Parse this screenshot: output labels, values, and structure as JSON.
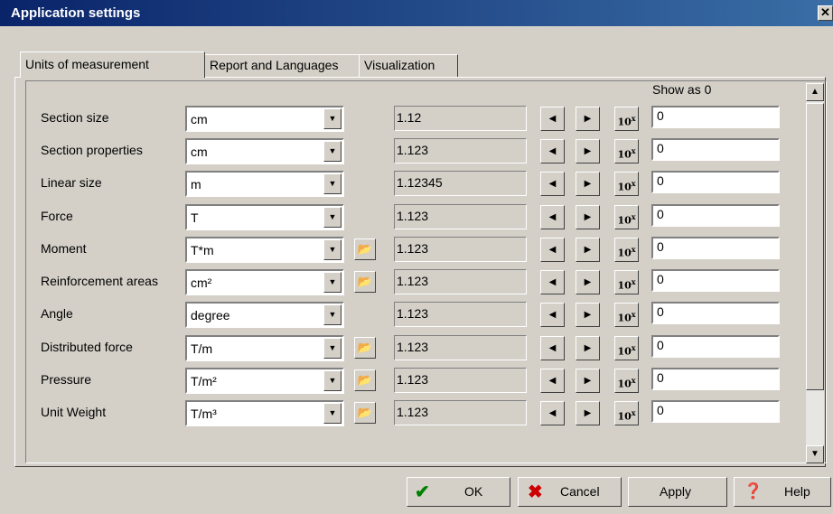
{
  "window": {
    "title": "Application settings",
    "close_glyph": "✕"
  },
  "tabs": [
    {
      "label": "Units of measurement",
      "active": true
    },
    {
      "label": "Report and Languages",
      "active": false
    },
    {
      "label": "Visualization",
      "active": false
    }
  ],
  "header": {
    "show_as_zero": "Show as 0"
  },
  "icons": {
    "left_arrow": "◀",
    "right_arrow": "▶",
    "dropdown": "▼",
    "folder": "📂",
    "power_base": "10",
    "power_exp": "x",
    "scroll_up": "▲",
    "scroll_down": "▼"
  },
  "rows": [
    {
      "label": "Section size",
      "unit": "cm",
      "has_folder": false,
      "format": "1.12",
      "zero": "0"
    },
    {
      "label": "Section properties",
      "unit": "cm",
      "has_folder": false,
      "format": "1.123",
      "zero": "0"
    },
    {
      "label": "Linear size",
      "unit": "m",
      "has_folder": false,
      "format": "1.12345",
      "zero": "0"
    },
    {
      "label": "Force",
      "unit": "T",
      "has_folder": false,
      "format": "1.123",
      "zero": "0"
    },
    {
      "label": "Moment",
      "unit": "T*m",
      "has_folder": true,
      "format": "1.123",
      "zero": "0"
    },
    {
      "label": "Reinforcement areas",
      "unit": "cm²",
      "has_folder": true,
      "format": "1.123",
      "zero": "0"
    },
    {
      "label": "Angle",
      "unit": "degree",
      "has_folder": false,
      "format": "1.123",
      "zero": "0"
    },
    {
      "label": "Distributed force",
      "unit": "T/m",
      "has_folder": true,
      "format": "1.123",
      "zero": "0"
    },
    {
      "label": "Pressure",
      "unit": "T/m²",
      "has_folder": true,
      "format": "1.123",
      "zero": "0"
    },
    {
      "label": "Unit Weight",
      "unit": "T/m³",
      "has_folder": true,
      "format": "1.123",
      "zero": "0"
    }
  ],
  "buttons": {
    "ok": {
      "label": "OK",
      "icon": "✔",
      "color": "#008000"
    },
    "cancel": {
      "label": "Cancel",
      "icon": "✖",
      "color": "#cc0000"
    },
    "apply": {
      "label": "Apply"
    },
    "help": {
      "label": "Help",
      "icon": "❓"
    }
  }
}
